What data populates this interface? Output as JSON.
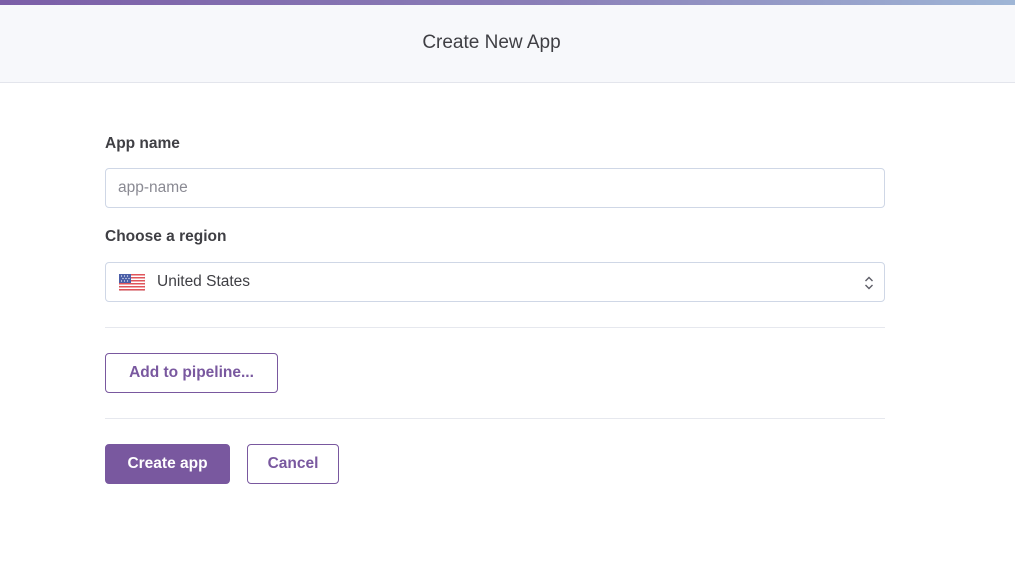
{
  "header": {
    "title": "Create New App"
  },
  "form": {
    "app_name": {
      "label": "App name",
      "placeholder": "app-name",
      "value": ""
    },
    "region": {
      "label": "Choose a region",
      "selected": "United States",
      "flag_icon": "us-flag-icon",
      "chevron_icon": "up-down-chevron-icon"
    },
    "add_pipeline_label": "Add to pipeline...",
    "create_label": "Create app",
    "cancel_label": "Cancel"
  },
  "colors": {
    "accent": "#79589f",
    "header_bg": "#f7f8fb",
    "text": "#3f3f44",
    "border": "#cfd7e6"
  }
}
